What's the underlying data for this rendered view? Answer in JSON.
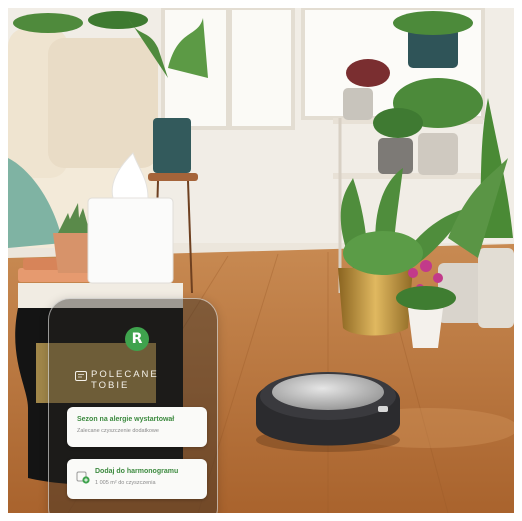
{
  "phone": {
    "app_logo": "R",
    "recommend_title_line1": "POLECANE",
    "recommend_title_line2": "TOBIE",
    "cards": [
      {
        "title": "Sezon na alergie wystartował",
        "subtitle": "Zalecane czyszczenie dodatkowe"
      },
      {
        "title": "Dodaj do harmonogramu",
        "subtitle": "1 005 m² do czyszczenia"
      }
    ],
    "icons": [
      "leaf-icon",
      "calendar-add-icon"
    ]
  },
  "colors": {
    "brand_green": "#3fa34d",
    "floor": "#b8733a",
    "wall": "#f1ede6"
  }
}
